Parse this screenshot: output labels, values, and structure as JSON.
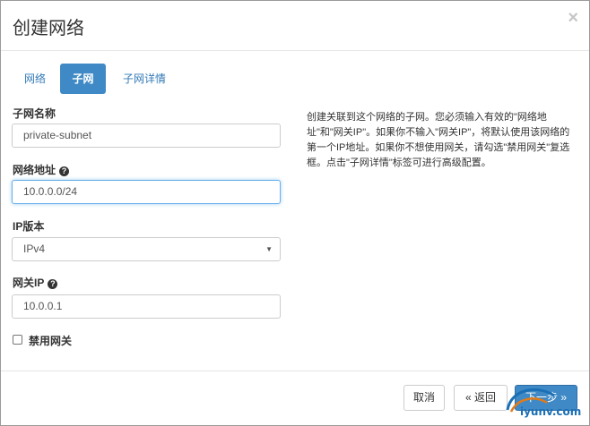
{
  "dialog": {
    "title": "创建网络",
    "close_glyph": "×"
  },
  "tabs": [
    {
      "label": "网络",
      "active": false
    },
    {
      "label": "子网",
      "active": true
    },
    {
      "label": "子网详情",
      "active": false
    }
  ],
  "form": {
    "subnet_name": {
      "label": "子网名称",
      "value": "private-subnet"
    },
    "network_address": {
      "label": "网络地址",
      "value": "10.0.0.0/24",
      "help_icon": "question-circle-icon"
    },
    "ip_version": {
      "label": "IP版本",
      "selected": "IPv4",
      "caret": "▼"
    },
    "gateway_ip": {
      "label": "网关IP",
      "value": "10.0.0.1",
      "help_icon": "question-circle-icon"
    },
    "disable_gateway": {
      "label": "禁用网关",
      "checked": false
    }
  },
  "description": "创建关联到这个网络的子网。您必须输入有效的\"网络地址\"和\"网关IP\"。如果你不输入\"网关IP\"，将默认使用该网络的第一个IP地址。如果你不想使用网关，请勾选\"禁用网关\"复选框。点击\"子网详情\"标签可进行高级配置。",
  "footer": {
    "cancel_label": "取消",
    "back_label": "« 返回",
    "next_label": "下一步 »"
  },
  "watermark": {
    "text": "iyunv.com"
  },
  "colors": {
    "primary": "#3f8ac6",
    "link": "#337ab7",
    "focus_border": "#66afe9"
  }
}
